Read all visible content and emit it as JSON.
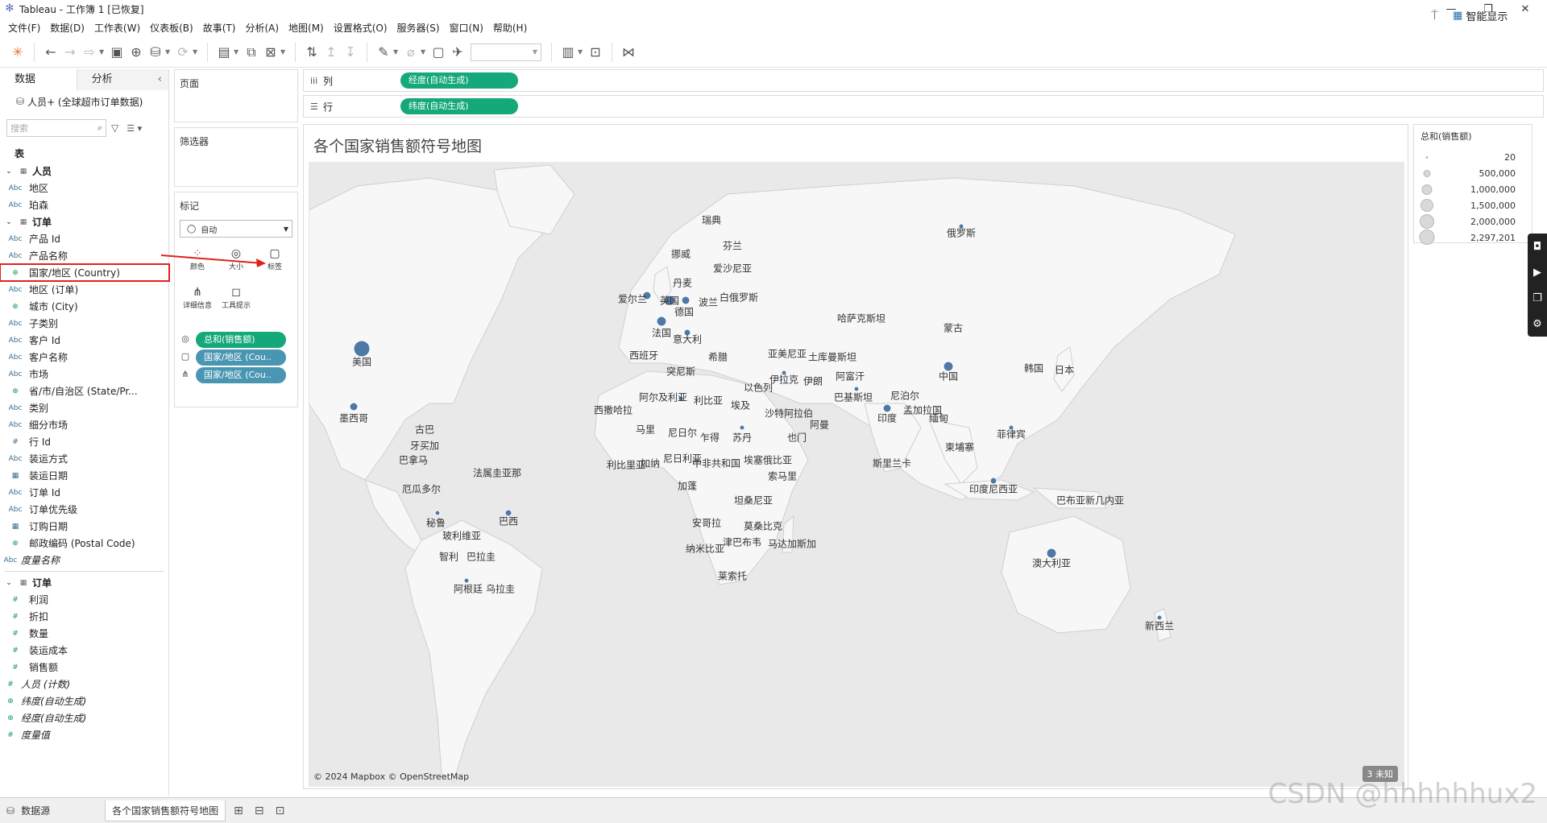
{
  "window": {
    "title": "Tableau - 工作簿 1 [已恢复]"
  },
  "menu": [
    "文件(F)",
    "数据(D)",
    "工作表(W)",
    "仪表板(B)",
    "故事(T)",
    "分析(A)",
    "地图(M)",
    "设置格式(O)",
    "服务器(S)",
    "窗口(N)",
    "帮助(H)"
  ],
  "toolbar": {
    "smart_show": "智能显示"
  },
  "left_pane": {
    "tab_data": "数据",
    "tab_analysis": "分析",
    "datasource": "人员+ (全球超市订单数据)",
    "search_placeholder": "搜索",
    "tables_header": "表",
    "tables": [
      {
        "name": "人员",
        "fields": [
          {
            "type": "Abc",
            "label": "地区"
          },
          {
            "type": "Abc",
            "label": "珀森"
          }
        ]
      },
      {
        "name": "订单",
        "fields": [
          {
            "type": "Abc",
            "label": "产品 Id"
          },
          {
            "type": "Abc",
            "label": "产品名称"
          },
          {
            "type": "geo",
            "label": "国家/地区 (Country)",
            "highlight": true
          },
          {
            "type": "Abc",
            "label": "地区 (订单)"
          },
          {
            "type": "geo",
            "label": "城市 (City)"
          },
          {
            "type": "Abc",
            "label": "子类别"
          },
          {
            "type": "Abc",
            "label": "客户 Id"
          },
          {
            "type": "Abc",
            "label": "客户名称"
          },
          {
            "type": "Abc",
            "label": "市场"
          },
          {
            "type": "geo",
            "label": "省/市/自治区 (State/Pr..."
          },
          {
            "type": "Abc",
            "label": "类别"
          },
          {
            "type": "Abc",
            "label": "细分市场"
          },
          {
            "type": "#",
            "label": "行 Id"
          },
          {
            "type": "Abc",
            "label": "装运方式"
          },
          {
            "type": "date",
            "label": "装运日期"
          },
          {
            "type": "Abc",
            "label": "订单 Id"
          },
          {
            "type": "Abc",
            "label": "订单优先级"
          },
          {
            "type": "date",
            "label": "订购日期"
          },
          {
            "type": "geo",
            "label": "邮政编码 (Postal Code)"
          }
        ]
      }
    ],
    "measure_names": "度量名称",
    "measures_table": "订单",
    "measures": [
      "利润",
      "折扣",
      "数量",
      "装运成本",
      "销售额"
    ],
    "extra_measures": [
      {
        "type": "#",
        "label": "人员 (计数)"
      },
      {
        "type": "geo",
        "label": "纬度(自动生成)"
      },
      {
        "type": "geo",
        "label": "经度(自动生成)"
      },
      {
        "type": "#",
        "label": "度量值"
      }
    ]
  },
  "shelves": {
    "pages_label": "页面",
    "filters_label": "筛选器",
    "marks_label": "标记",
    "marks_type": "自动",
    "mark_buttons": [
      "颜色",
      "大小",
      "标签",
      "详细信息",
      "工具提示"
    ],
    "mark_pills": [
      "总和(销售额)",
      "国家/地区 (Cou..",
      "国家/地区 (Cou.."
    ],
    "columns_label": "列",
    "rows_label": "行",
    "columns_pill": "经度(自动生成)",
    "rows_pill": "纬度(自动生成)"
  },
  "view": {
    "title": "各个国家销售额符号地图",
    "copyright": "© 2024 Mapbox © OpenStreetMap",
    "unknown_badge": "3 未知",
    "country_labels": [
      "瑞典",
      "芬兰",
      "挪威",
      "俄罗斯",
      "丹麦",
      "爱沙尼亚",
      "爱尔兰",
      "英国",
      "德国",
      "白俄罗斯",
      "波兰",
      "法国",
      "意大利",
      "西班牙",
      "希腊",
      "亚美尼亚",
      "土库曼斯坦",
      "哈萨克斯坦",
      "蒙古",
      "中国",
      "韩国",
      "日本",
      "突尼斯",
      "阿尔及利亚",
      "利比亚",
      "埃及",
      "以色列",
      "伊拉克",
      "伊朗",
      "阿富汗",
      "巴基斯坦",
      "尼泊尔",
      "印度",
      "孟加拉国",
      "缅甸",
      "沙特阿拉伯",
      "阿曼",
      "也门",
      "西撒哈拉",
      "马里",
      "尼日尔",
      "乍得",
      "苏丹",
      "菲律宾",
      "柬埔寨",
      "斯里兰卡",
      "美国",
      "墨西哥",
      "古巴",
      "牙买加",
      "巴拿马",
      "法属圭亚那",
      "厄瓜多尔",
      "巴西",
      "秘鲁",
      "玻利维亚",
      "智利",
      "巴拉圭",
      "阿根廷",
      "乌拉圭",
      "利比里亚",
      "加纳",
      "尼日利亚",
      "中非共和国",
      "加蓬",
      "埃塞俄比亚",
      "索马里",
      "坦桑尼亚",
      "安哥拉",
      "莫桑比克",
      "津巴布韦",
      "纳米比亚",
      "马达加斯加",
      "莱索托",
      "印度尼西亚",
      "巴布亚新几内亚",
      "澳大利亚",
      "新西兰"
    ]
  },
  "legend": {
    "title": "总和(销售额)",
    "items": [
      "20",
      "500,000",
      "1,000,000",
      "1,500,000",
      "2,000,000",
      "2,297,201"
    ]
  },
  "bottom_tabs": {
    "datasource": "数据源",
    "sheet": "各个国家销售额符号地图"
  },
  "watermark": "CSDN @hhhhhhux2",
  "colors": {
    "accent_green": "#14a87a",
    "accent_teal": "#4996b2",
    "mark_blue": "#4e79a7",
    "highlight_red": "#e0221c"
  }
}
